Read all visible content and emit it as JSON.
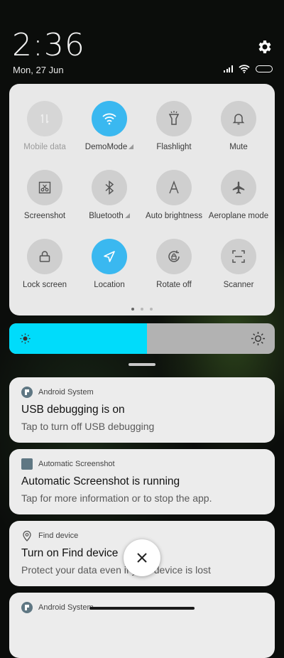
{
  "status": {
    "time": "2:36",
    "date": "Mon, 27 Jun"
  },
  "quick_settings": {
    "tiles": [
      {
        "label": "Mobile data",
        "icon": "mobile-data-icon",
        "state": "disabled"
      },
      {
        "label": "DemoMode",
        "icon": "wifi-icon",
        "state": "active"
      },
      {
        "label": "Flashlight",
        "icon": "flashlight-icon",
        "state": "off"
      },
      {
        "label": "Mute",
        "icon": "bell-icon",
        "state": "off"
      },
      {
        "label": "Screenshot",
        "icon": "screenshot-icon",
        "state": "off"
      },
      {
        "label": "Bluetooth",
        "icon": "bluetooth-icon",
        "state": "off"
      },
      {
        "label": "Auto brightness",
        "icon": "auto-brightness-icon",
        "state": "off"
      },
      {
        "label": "Aeroplane mode",
        "icon": "airplane-icon",
        "state": "off"
      },
      {
        "label": "Lock screen",
        "icon": "lock-icon",
        "state": "off"
      },
      {
        "label": "Location",
        "icon": "location-icon",
        "state": "active"
      },
      {
        "label": "Rotate off",
        "icon": "rotate-lock-icon",
        "state": "off"
      },
      {
        "label": "Scanner",
        "icon": "scanner-icon",
        "state": "off"
      }
    ],
    "page_count": 3,
    "current_page": 1
  },
  "brightness": {
    "level": 0.52
  },
  "notifications": [
    {
      "app": "Android System",
      "app_icon": "android-system-icon",
      "title": "USB debugging is on",
      "body": "Tap to turn off USB debugging"
    },
    {
      "app": "Automatic Screenshot",
      "app_icon": "automatic-screenshot-icon",
      "title": "Automatic Screenshot is running",
      "body": "Tap for more information or to stop the app."
    },
    {
      "app": "Find device",
      "app_icon": "find-device-icon",
      "title": "Turn on Find device",
      "body": "Protect your data even if your device is lost"
    },
    {
      "app": "Android System",
      "app_icon": "android-system-icon",
      "title": "",
      "body": ""
    }
  ],
  "colors": {
    "active_tile": "#3ab8f0",
    "brightness_fill": "#00dcfb",
    "panel": "#e8e8e8"
  }
}
